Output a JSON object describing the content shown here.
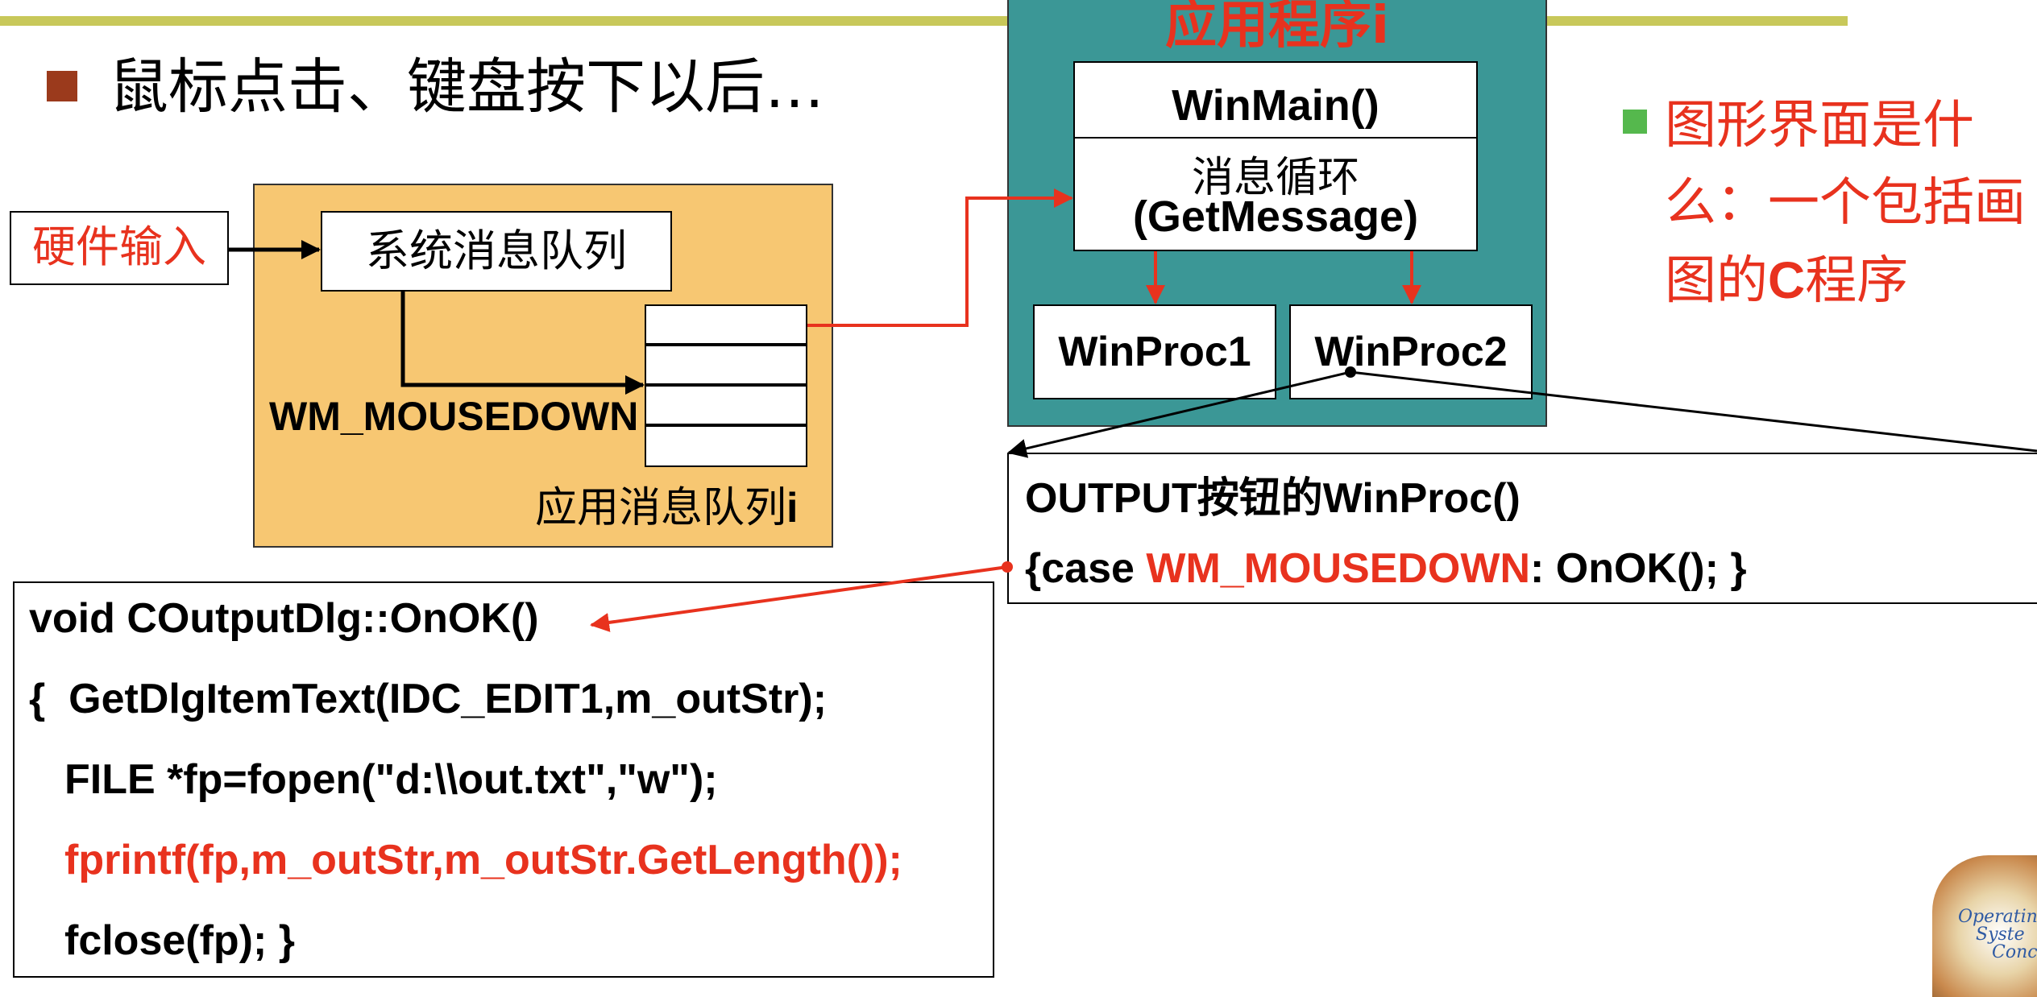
{
  "title": "鼠标点击、键盘按下以后…",
  "hardware_input": "硬件输入",
  "system_queue": "系统消息队列",
  "message_label": "WM_MOUSEDOWN",
  "app_queue_label": {
    "text": "应用消息队列",
    "suffix": "i"
  },
  "app": {
    "title": "应用程序i",
    "winmain": "WinMain()",
    "loop_line1": "消息循环",
    "loop_line2": "(GetMessage)",
    "winproc1": "WinProc1",
    "winproc2": "WinProc2"
  },
  "note": {
    "part1": "图形界面是什么：一个包括画图的",
    "bold": "C",
    "part2": "程序"
  },
  "output_box": {
    "line1_bold": "OUTPUT",
    "line1_mid": "按钮的",
    "line1_end": "WinProc()",
    "line2_start": "{case ",
    "line2_red": "WM_MOUSEDOWN",
    "line2_end": ": OnOK(); }"
  },
  "code": {
    "line1": "void COutputDlg::OnOK()",
    "line2": "{  GetDlgItemText(IDC_EDIT1,m_outStr);",
    "line3": "FILE *fp=fopen(\"d:\\\\out.txt\",\"w\");",
    "line4": "fprintf(fp,m_outStr,m_outStr.GetLength());",
    "line5": "fclose(fp); }"
  },
  "logo_text": [
    "Operatin",
    "Syste",
    "Conc"
  ],
  "colors": {
    "accent_red": "#e8321e",
    "teal": "#3b9796",
    "orange": "#f7c772",
    "top_bar": "#c8c85a",
    "bullet_brown": "#9b3a1c",
    "bullet_green": "#55b84d"
  }
}
